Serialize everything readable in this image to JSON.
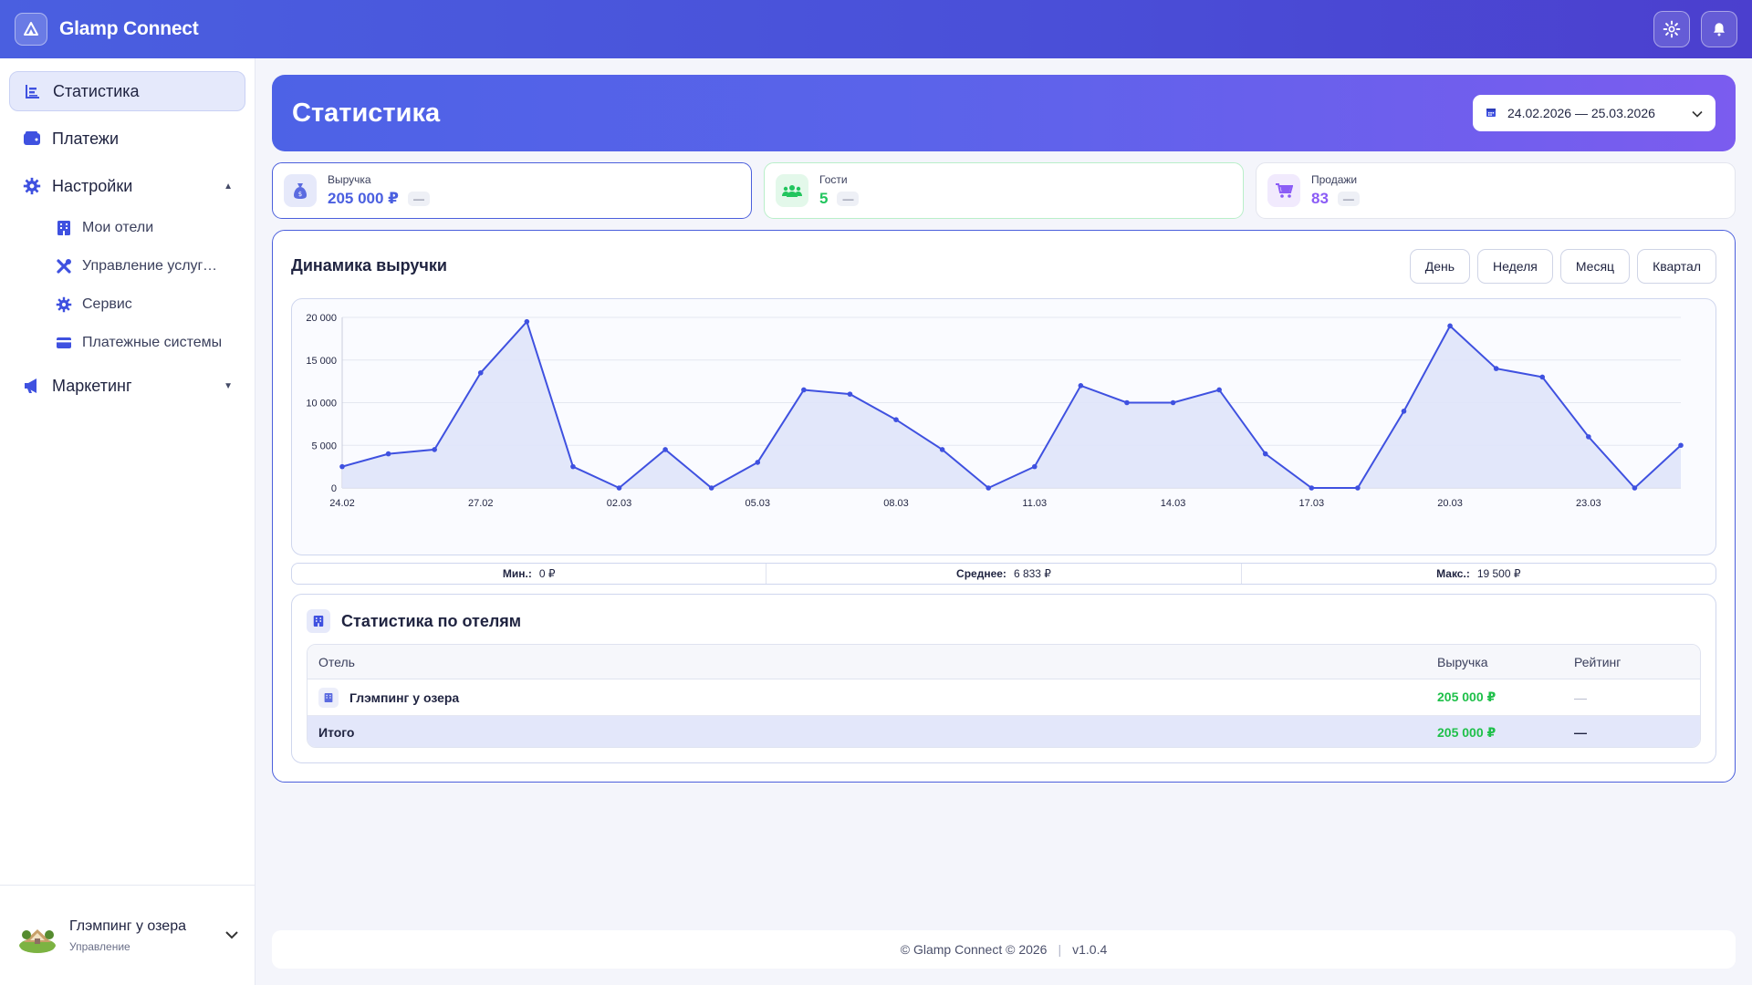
{
  "app": {
    "title": "Glamp Connect"
  },
  "sidebar": {
    "items": [
      {
        "label": "Статистика",
        "icon": "chart-icon",
        "active": true
      },
      {
        "label": "Платежи",
        "icon": "wallet-icon"
      },
      {
        "label": "Настройки",
        "icon": "gear-icon",
        "expanded": true
      },
      {
        "label": "Маркетинг",
        "icon": "megaphone-icon",
        "expanded": false
      }
    ],
    "settings_sub": [
      {
        "label": "Мои отели",
        "icon": "building-icon"
      },
      {
        "label": "Управление услугами",
        "icon": "tools-icon"
      },
      {
        "label": "Сервис",
        "icon": "gear-icon"
      },
      {
        "label": "Платежные системы",
        "icon": "credit-card-icon"
      }
    ],
    "footer": {
      "hotel_name": "Глэмпинг у озера",
      "role": "Управление"
    }
  },
  "hero": {
    "title": "Статистика",
    "date_range": "24.02.2026 — 25.03.2026"
  },
  "kpis": [
    {
      "label": "Выручка",
      "value": "205 000 ₽",
      "delta": "—",
      "color": "#4a5fe0"
    },
    {
      "label": "Гости",
      "value": "5",
      "delta": "—",
      "color": "#22c55e"
    },
    {
      "label": "Продажи",
      "value": "83",
      "delta": "—",
      "color": "#8b5cf6"
    }
  ],
  "revenue": {
    "title": "Динамика выручки",
    "periods": [
      "День",
      "Неделя",
      "Месяц",
      "Квартал"
    ],
    "stats": {
      "min_label": "Мин.:",
      "min": "0 ₽",
      "avg_label": "Среднее:",
      "avg": "6 833 ₽",
      "max_label": "Макс.:",
      "max": "19 500 ₽"
    }
  },
  "chart_data": {
    "type": "area",
    "x": [
      "24.02",
      "25.02",
      "26.02",
      "27.02",
      "28.02",
      "01.03",
      "02.03",
      "03.03",
      "04.03",
      "05.03",
      "06.03",
      "07.03",
      "08.03",
      "09.03",
      "10.03",
      "11.03",
      "12.03",
      "13.03",
      "14.03",
      "15.03",
      "16.03",
      "17.03",
      "18.03",
      "19.03",
      "20.03",
      "21.03",
      "22.03",
      "23.03",
      "24.03",
      "25.03"
    ],
    "x_tick_labels": [
      "24.02",
      "27.02",
      "02.03",
      "05.03",
      "08.03",
      "11.03",
      "14.03",
      "17.03",
      "20.03",
      "23.03"
    ],
    "values": [
      2500,
      4000,
      4500,
      13500,
      19500,
      2500,
      0,
      4500,
      0,
      3000,
      11500,
      11000,
      8000,
      4500,
      0,
      2500,
      12000,
      10000,
      10000,
      11500,
      4000,
      0,
      0,
      9000,
      19000,
      14000,
      13000,
      6000,
      0,
      5000
    ],
    "ylim": [
      0,
      20000
    ],
    "yticks": [
      "0",
      "5 000",
      "10 000",
      "15 000",
      "20 000"
    ],
    "grid": true,
    "line_color": "#3f51e0",
    "fill_color": "#dfe4fa"
  },
  "hotels": {
    "title": "Статистика по отелям",
    "columns": [
      "Отель",
      "Выручка",
      "Рейтинг"
    ],
    "rows": [
      {
        "name": "Глэмпинг у озера",
        "revenue": "205 000 ₽",
        "rating": "—"
      }
    ],
    "total": {
      "label": "Итого",
      "revenue": "205 000 ₽",
      "rating": "—"
    }
  },
  "footer": {
    "copyright": "© Glamp Connect © 2026",
    "version": "v1.0.4"
  }
}
